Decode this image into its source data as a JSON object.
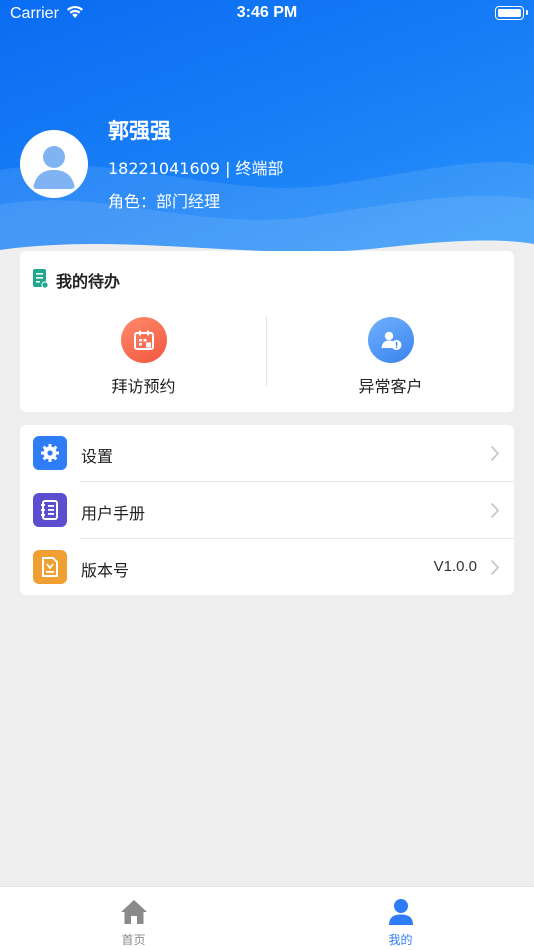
{
  "status_bar": {
    "carrier": "Carrier",
    "time": "3:46 PM"
  },
  "profile": {
    "name": "郭强强",
    "phone_dept": "18221041609 | 终端部",
    "role": "角色：部门经理"
  },
  "todo": {
    "title": "我的待办",
    "items": [
      {
        "label": "拜访预约",
        "icon": "calendar-icon",
        "color": "#f2573e"
      },
      {
        "label": "异常客户",
        "icon": "user-alert-icon",
        "color": "#3a83ee"
      }
    ]
  },
  "menu": {
    "items": [
      {
        "label": "设置",
        "icon": "gear-icon",
        "color": "#2f7df6",
        "value": ""
      },
      {
        "label": "用户手册",
        "icon": "manual-icon",
        "color": "#5b4fcf",
        "value": ""
      },
      {
        "label": "版本号",
        "icon": "version-icon",
        "color": "#f0a033",
        "value": "V1.0.0"
      }
    ]
  },
  "tabbar": {
    "tabs": [
      {
        "label": "首页",
        "icon": "home-icon",
        "active": false
      },
      {
        "label": "我的",
        "icon": "person-icon",
        "active": true
      }
    ],
    "active_color": "#2f7df6",
    "inactive_color": "#8a8a8a"
  },
  "colors": {
    "header_start": "#0a6cf2",
    "header_end": "#2f9bfb",
    "background": "#eeeeee"
  }
}
